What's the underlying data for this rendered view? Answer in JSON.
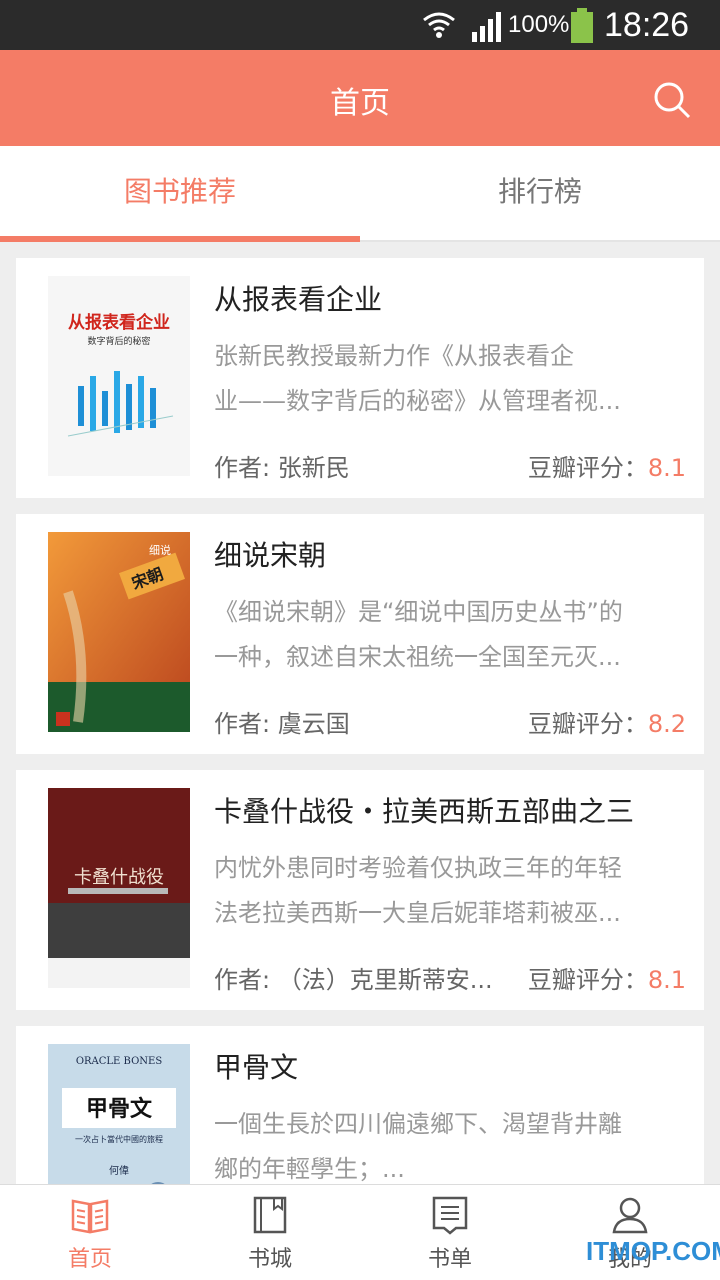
{
  "status_bar": {
    "battery_percent": "100%",
    "time": "18:26",
    "icons": [
      "wifi-icon",
      "signal-icon",
      "battery-icon"
    ]
  },
  "app_bar": {
    "title": "首页",
    "search_icon": "search-icon"
  },
  "tabs": [
    {
      "label": "图书推荐",
      "active": true
    },
    {
      "label": "排行榜",
      "active": false
    }
  ],
  "books": [
    {
      "title": "从报表看企业",
      "desc_line1": "张新民教授最新力作《从报表看企",
      "desc_line2": "业——数字背后的秘密》从管理者视...",
      "author": "作者: 张新民",
      "rating_label": "豆瓣评分：",
      "rating": "8.1",
      "cover_title": "从报表看企业",
      "cover_subtitle": "数字背后的秘密"
    },
    {
      "title": "细说宋朝",
      "desc_line1": "《细说宋朝》是“细说中国历史丛书”的",
      "desc_line2": "一种，叙述自宋太祖统一全国至元灭...",
      "author": "作者: 虞云国",
      "rating_label": "豆瓣评分：",
      "rating": "8.2",
      "cover_title": "宋朝",
      "cover_subtitle": "细说"
    },
    {
      "title": "卡叠什战役・拉美西斯五部曲之三",
      "desc_line1": "内忧外患同时考验着仅执政三年的年轻",
      "desc_line2": "法老拉美西斯一大皇后妮菲塔莉被巫...",
      "author": "作者: （法）克里斯蒂安...",
      "rating_label": "豆瓣评分：",
      "rating": "8.1",
      "cover_title": "卡叠什战役"
    },
    {
      "title": "甲骨文",
      "desc_line1": "一個生長於四川偏遠鄉下、渴望背井離",
      "desc_line2": "鄉的年輕學生；...",
      "author": "",
      "rating_label": "",
      "rating": "",
      "cover_title": "甲骨文",
      "cover_subtitle": "一次占卜當代中國的旅程",
      "cover_en": "ORACLE BONES",
      "cover_author": "何偉"
    }
  ],
  "nav": [
    {
      "label": "首页",
      "icon": "book-open-icon",
      "active": true
    },
    {
      "label": "书城",
      "icon": "book-icon",
      "active": false
    },
    {
      "label": "书单",
      "icon": "list-icon",
      "active": false
    },
    {
      "label": "我的",
      "icon": "person-icon",
      "active": false
    }
  ],
  "watermark": "ITMOP.COM",
  "colors": {
    "accent": "#f47c66",
    "status_bar": "#2b2b2b",
    "background": "#eeeeee"
  }
}
